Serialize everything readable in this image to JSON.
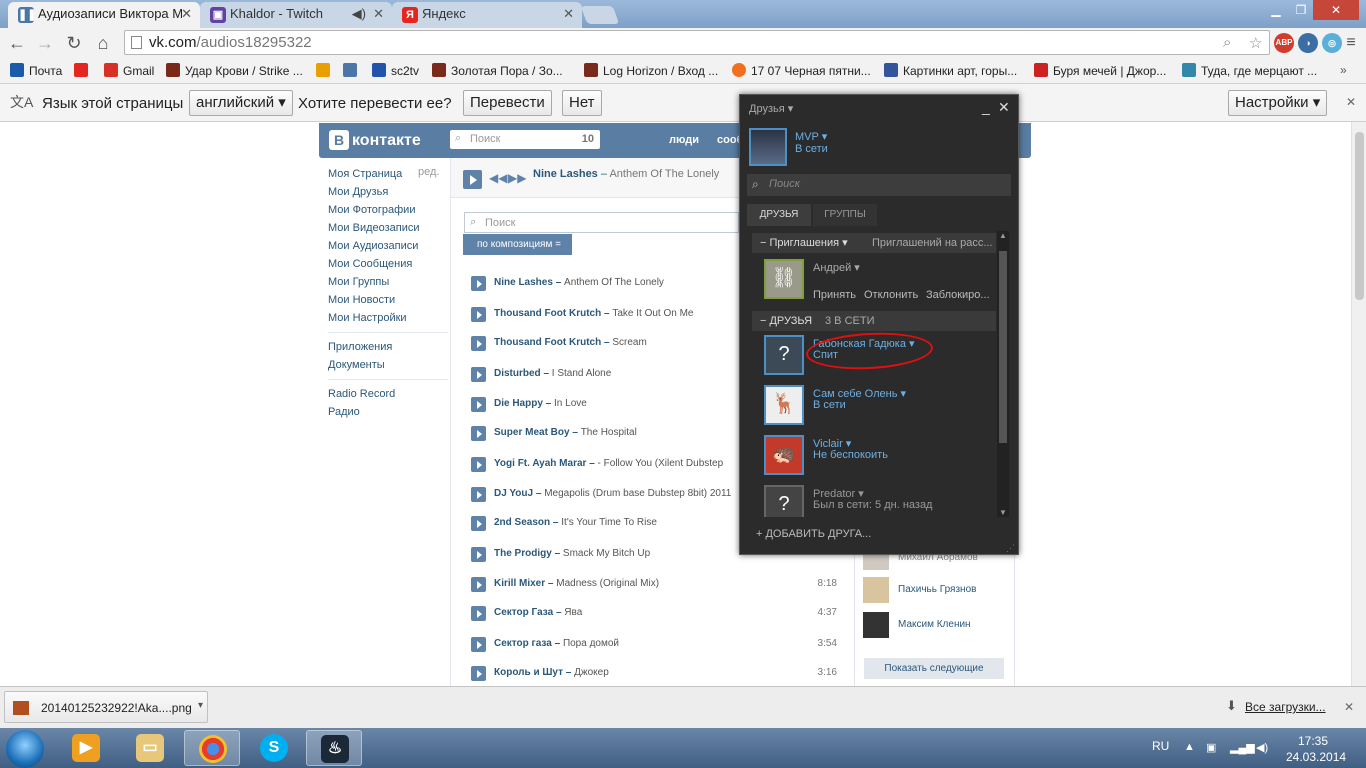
{
  "browser": {
    "tabs": [
      {
        "title": "Аудиозаписи Виктора М",
        "favicon": "vk-pause-icon"
      },
      {
        "title": "Khaldor - Twitch",
        "favicon": "twitch-icon"
      },
      {
        "title": "Яндекс",
        "favicon": "yandex-icon"
      }
    ],
    "tab_close": "✕",
    "url_host": "vk.com",
    "url_path": "/audios18295322",
    "abp": "ABP"
  },
  "bookmarks": [
    {
      "label": "Почта",
      "color": "#1a5aa8"
    },
    {
      "label": "",
      "color": "#e52620"
    },
    {
      "label": "Gmail",
      "color": "#d93025"
    },
    {
      "label": "Удар Крови / Strike ...",
      "color": "#7a2a1a"
    },
    {
      "label": "",
      "color": "#e8a000"
    },
    {
      "label": "",
      "color": "#4a76a8"
    },
    {
      "label": "sc2tv",
      "color": "#2255aa"
    },
    {
      "label": "Золотая Пора / Зо...",
      "color": "#7a2a1a"
    },
    {
      "label": "Log Horizon / Вход ...",
      "color": "#7a2a1a"
    },
    {
      "label": "17 07 Черная пятни...",
      "color": "#f07020"
    },
    {
      "label": "Картинки арт, горы...",
      "color": "#335599"
    },
    {
      "label": "Буря мечей | Джор...",
      "color": "#cc2222"
    },
    {
      "label": "Туда, где мерцают ...",
      "color": "#3388aa"
    }
  ],
  "translate": {
    "prompt": "Язык этой страницы",
    "language": "английский ▾",
    "question": "Хотите перевести ее?",
    "translate_btn": "Перевести",
    "no_btn": "Нет",
    "settings_btn": "Настройки ▾"
  },
  "vk": {
    "logo": "контакте",
    "logo_letter": "В",
    "search_placeholder": "Поиск",
    "search_count": "10",
    "header_links": [
      "люди",
      "сооб"
    ],
    "edit": "ред.",
    "menu": [
      "Моя Страница",
      "Мои Друзья",
      "Мои Фотографии",
      "Мои Видеозаписи",
      "Мои Аудиозаписи",
      "Мои Сообщения",
      "Мои Группы",
      "Мои Новости",
      "Мои Настройки"
    ],
    "menu2": [
      "Приложения",
      "Документы"
    ],
    "menu3": [
      "Radio Record",
      "Радио"
    ],
    "now_artist": "Nine Lashes",
    "now_title": "Anthem Of The Lonely",
    "audio_search_placeholder": "Поиск",
    "sort_label": "по композициям  =",
    "tracks": [
      {
        "artist": "Nine Lashes",
        "title": "Anthem Of The Lonely",
        "duration": ""
      },
      {
        "artist": "Thousand Foot Krutch",
        "title": "Take It Out On Me",
        "duration": ""
      },
      {
        "artist": "Thousand Foot Krutch",
        "title": "Scream",
        "duration": ""
      },
      {
        "artist": "Disturbed",
        "title": "I Stand Alone",
        "duration": ""
      },
      {
        "artist": "Die Happy",
        "title": "In Love",
        "duration": ""
      },
      {
        "artist": "Super Meat Boy",
        "title": "The Hospital",
        "duration": ""
      },
      {
        "artist": "Yogi Ft. Ayah Marar",
        "title": "- Follow You (Xilent Dubstep",
        "duration": ""
      },
      {
        "artist": "DJ YouJ",
        "title": "Megapolis (Drum base Dubstep 8bit) 2011",
        "duration": ""
      },
      {
        "artist": "2nd Season",
        "title": "It's Your Time To Rise",
        "duration": ""
      },
      {
        "artist": "The Prodigy",
        "title": "Smack My Bitch Up",
        "duration": ""
      },
      {
        "artist": "Kirill Mixer",
        "title": "Madness (Original Mix)",
        "duration": "8:18"
      },
      {
        "artist": "Сектор Газа",
        "title": "Ява",
        "duration": "4:37"
      },
      {
        "artist": "Сектор газа",
        "title": "Пора домой",
        "duration": "3:54"
      },
      {
        "artist": "Король и Шут",
        "title": "Джокер",
        "duration": "3:16"
      }
    ],
    "right_friends": [
      "Михаил Абрамов",
      "Пахичьь Грязнов",
      "Максим Кленин"
    ],
    "show_next": "Показать следующие"
  },
  "steam": {
    "title": "Друзья ▾",
    "minimize": "_",
    "close": "✕",
    "me_name": "MVP ▾",
    "me_status": "В сети",
    "search_placeholder": "Поиск",
    "tab_friends": "ДРУЗЬЯ",
    "tab_groups": "ГРУППЫ",
    "invites_group": "−  Приглашения ▾",
    "invites_sent": "Приглашений на расс...",
    "invite_name": "Андрей ▾",
    "invite_accept": "Принять",
    "invite_decline": "Отклонить",
    "invite_block": "Заблокиро...",
    "friends_group": "−  ДРУЗЬЯ",
    "friends_online": "3 В СЕТИ",
    "friends": [
      {
        "name": "Габонская Гадюка ▾",
        "status": "Спит",
        "avatar": "?"
      },
      {
        "name": "Сам себе Олень ▾",
        "status": "В сети",
        "avatar": "🦌"
      },
      {
        "name": "Viclair ▾",
        "status": "Не беспокоить",
        "avatar": "🦔"
      },
      {
        "name": "Predator ▾",
        "status": "Был в сети: 5 дн. назад",
        "avatar": "?"
      }
    ],
    "add_friend": "+   ДОБАВИТЬ ДРУГА..."
  },
  "downloads": {
    "file": "20140125232922!Aka....png",
    "show_all": "Все загрузки...",
    "close": "✕"
  },
  "taskbar": {
    "lang": "RU",
    "time": "17:35",
    "date": "24.03.2014"
  }
}
